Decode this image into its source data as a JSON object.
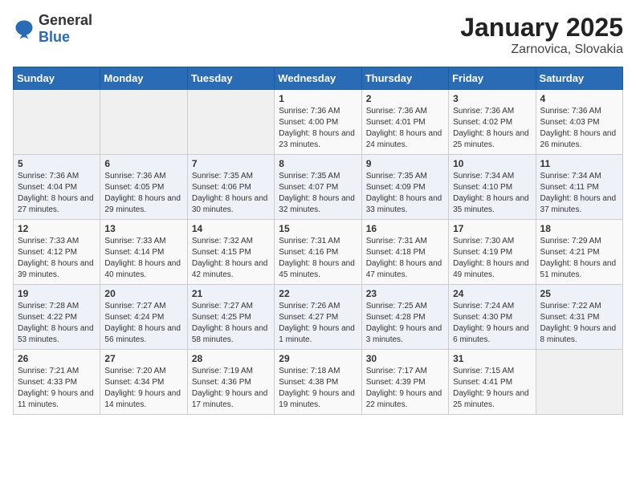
{
  "logo": {
    "general": "General",
    "blue": "Blue"
  },
  "title": "January 2025",
  "subtitle": "Zarnovica, Slovakia",
  "weekdays": [
    "Sunday",
    "Monday",
    "Tuesday",
    "Wednesday",
    "Thursday",
    "Friday",
    "Saturday"
  ],
  "weeks": [
    [
      {
        "day": "",
        "sunrise": "",
        "sunset": "",
        "daylight": ""
      },
      {
        "day": "",
        "sunrise": "",
        "sunset": "",
        "daylight": ""
      },
      {
        "day": "",
        "sunrise": "",
        "sunset": "",
        "daylight": ""
      },
      {
        "day": "1",
        "sunrise": "Sunrise: 7:36 AM",
        "sunset": "Sunset: 4:00 PM",
        "daylight": "Daylight: 8 hours and 23 minutes."
      },
      {
        "day": "2",
        "sunrise": "Sunrise: 7:36 AM",
        "sunset": "Sunset: 4:01 PM",
        "daylight": "Daylight: 8 hours and 24 minutes."
      },
      {
        "day": "3",
        "sunrise": "Sunrise: 7:36 AM",
        "sunset": "Sunset: 4:02 PM",
        "daylight": "Daylight: 8 hours and 25 minutes."
      },
      {
        "day": "4",
        "sunrise": "Sunrise: 7:36 AM",
        "sunset": "Sunset: 4:03 PM",
        "daylight": "Daylight: 8 hours and 26 minutes."
      }
    ],
    [
      {
        "day": "5",
        "sunrise": "Sunrise: 7:36 AM",
        "sunset": "Sunset: 4:04 PM",
        "daylight": "Daylight: 8 hours and 27 minutes."
      },
      {
        "day": "6",
        "sunrise": "Sunrise: 7:36 AM",
        "sunset": "Sunset: 4:05 PM",
        "daylight": "Daylight: 8 hours and 29 minutes."
      },
      {
        "day": "7",
        "sunrise": "Sunrise: 7:35 AM",
        "sunset": "Sunset: 4:06 PM",
        "daylight": "Daylight: 8 hours and 30 minutes."
      },
      {
        "day": "8",
        "sunrise": "Sunrise: 7:35 AM",
        "sunset": "Sunset: 4:07 PM",
        "daylight": "Daylight: 8 hours and 32 minutes."
      },
      {
        "day": "9",
        "sunrise": "Sunrise: 7:35 AM",
        "sunset": "Sunset: 4:09 PM",
        "daylight": "Daylight: 8 hours and 33 minutes."
      },
      {
        "day": "10",
        "sunrise": "Sunrise: 7:34 AM",
        "sunset": "Sunset: 4:10 PM",
        "daylight": "Daylight: 8 hours and 35 minutes."
      },
      {
        "day": "11",
        "sunrise": "Sunrise: 7:34 AM",
        "sunset": "Sunset: 4:11 PM",
        "daylight": "Daylight: 8 hours and 37 minutes."
      }
    ],
    [
      {
        "day": "12",
        "sunrise": "Sunrise: 7:33 AM",
        "sunset": "Sunset: 4:12 PM",
        "daylight": "Daylight: 8 hours and 39 minutes."
      },
      {
        "day": "13",
        "sunrise": "Sunrise: 7:33 AM",
        "sunset": "Sunset: 4:14 PM",
        "daylight": "Daylight: 8 hours and 40 minutes."
      },
      {
        "day": "14",
        "sunrise": "Sunrise: 7:32 AM",
        "sunset": "Sunset: 4:15 PM",
        "daylight": "Daylight: 8 hours and 42 minutes."
      },
      {
        "day": "15",
        "sunrise": "Sunrise: 7:31 AM",
        "sunset": "Sunset: 4:16 PM",
        "daylight": "Daylight: 8 hours and 45 minutes."
      },
      {
        "day": "16",
        "sunrise": "Sunrise: 7:31 AM",
        "sunset": "Sunset: 4:18 PM",
        "daylight": "Daylight: 8 hours and 47 minutes."
      },
      {
        "day": "17",
        "sunrise": "Sunrise: 7:30 AM",
        "sunset": "Sunset: 4:19 PM",
        "daylight": "Daylight: 8 hours and 49 minutes."
      },
      {
        "day": "18",
        "sunrise": "Sunrise: 7:29 AM",
        "sunset": "Sunset: 4:21 PM",
        "daylight": "Daylight: 8 hours and 51 minutes."
      }
    ],
    [
      {
        "day": "19",
        "sunrise": "Sunrise: 7:28 AM",
        "sunset": "Sunset: 4:22 PM",
        "daylight": "Daylight: 8 hours and 53 minutes."
      },
      {
        "day": "20",
        "sunrise": "Sunrise: 7:27 AM",
        "sunset": "Sunset: 4:24 PM",
        "daylight": "Daylight: 8 hours and 56 minutes."
      },
      {
        "day": "21",
        "sunrise": "Sunrise: 7:27 AM",
        "sunset": "Sunset: 4:25 PM",
        "daylight": "Daylight: 8 hours and 58 minutes."
      },
      {
        "day": "22",
        "sunrise": "Sunrise: 7:26 AM",
        "sunset": "Sunset: 4:27 PM",
        "daylight": "Daylight: 9 hours and 1 minute."
      },
      {
        "day": "23",
        "sunrise": "Sunrise: 7:25 AM",
        "sunset": "Sunset: 4:28 PM",
        "daylight": "Daylight: 9 hours and 3 minutes."
      },
      {
        "day": "24",
        "sunrise": "Sunrise: 7:24 AM",
        "sunset": "Sunset: 4:30 PM",
        "daylight": "Daylight: 9 hours and 6 minutes."
      },
      {
        "day": "25",
        "sunrise": "Sunrise: 7:22 AM",
        "sunset": "Sunset: 4:31 PM",
        "daylight": "Daylight: 9 hours and 8 minutes."
      }
    ],
    [
      {
        "day": "26",
        "sunrise": "Sunrise: 7:21 AM",
        "sunset": "Sunset: 4:33 PM",
        "daylight": "Daylight: 9 hours and 11 minutes."
      },
      {
        "day": "27",
        "sunrise": "Sunrise: 7:20 AM",
        "sunset": "Sunset: 4:34 PM",
        "daylight": "Daylight: 9 hours and 14 minutes."
      },
      {
        "day": "28",
        "sunrise": "Sunrise: 7:19 AM",
        "sunset": "Sunset: 4:36 PM",
        "daylight": "Daylight: 9 hours and 17 minutes."
      },
      {
        "day": "29",
        "sunrise": "Sunrise: 7:18 AM",
        "sunset": "Sunset: 4:38 PM",
        "daylight": "Daylight: 9 hours and 19 minutes."
      },
      {
        "day": "30",
        "sunrise": "Sunrise: 7:17 AM",
        "sunset": "Sunset: 4:39 PM",
        "daylight": "Daylight: 9 hours and 22 minutes."
      },
      {
        "day": "31",
        "sunrise": "Sunrise: 7:15 AM",
        "sunset": "Sunset: 4:41 PM",
        "daylight": "Daylight: 9 hours and 25 minutes."
      },
      {
        "day": "",
        "sunrise": "",
        "sunset": "",
        "daylight": ""
      }
    ]
  ]
}
